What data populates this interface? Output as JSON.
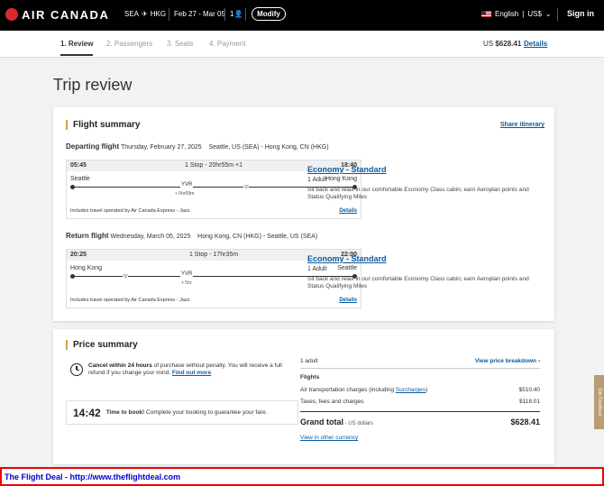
{
  "header": {
    "brand": "AIR CANADA",
    "origin": "SEA",
    "plane_icon": "✈",
    "destination": "HKG",
    "dates": "Feb 27 - Mar 05",
    "passengers": "1",
    "modify_label": "Modify",
    "language": "English",
    "currency": "US$",
    "sign_in": "Sign in"
  },
  "steps": [
    {
      "label": "1. Review"
    },
    {
      "label": "2. Passengers"
    },
    {
      "label": "3. Seats"
    },
    {
      "label": "4. Payment"
    }
  ],
  "top_total": {
    "prefix": "US",
    "amount": "$628.41",
    "details": "Details"
  },
  "page_title": "Trip review",
  "flight_summary": {
    "title": "Flight summary",
    "share": "Share itinerary",
    "departing": {
      "label": "Departing flight",
      "date": "Thursday, February 27, 2025",
      "route": "Seattle, US (SEA) - Hong Kong, CN (HKG)",
      "dep_time": "05:45",
      "stops": "1 Stop - 20hr55m +1",
      "arr_time": "18:40",
      "from_city": "Seattle",
      "to_city": "Hong Kong",
      "stop_code": "YVR",
      "layover": "+ 5hr09m",
      "operated": "Includes travel operated by Air Canada Express - Jazz.",
      "details": "Details",
      "fare_name": "Economy - Standard",
      "fare_pax": "1 Adult",
      "fare_desc": "Sit back and relax in our comfortable Economy Class cabin; earn Aeroplan points and Status Qualifying Miles"
    },
    "return": {
      "label": "Return flight",
      "date": "Wednesday, March 05, 2025",
      "route": "Hong Kong, CN (HKG) - Seattle, US (SEA)",
      "dep_time": "20:25",
      "stops": "1 Stop - 17hr35m",
      "arr_time": "22:00",
      "from_city": "Hong Kong",
      "to_city": "Seattle",
      "stop_code": "YVR",
      "layover": "+ 5hr",
      "operated": "Includes travel operated by Air Canada Express - Jazz.",
      "details": "Details",
      "fare_name": "Economy - Standard",
      "fare_pax": "1 Adult",
      "fare_desc": "Sit back and relax in our comfortable Economy Class cabin; earn Aeroplan points and Status Qualifying Miles"
    }
  },
  "price_summary": {
    "title": "Price summary",
    "cancel_bold": "Cancel within 24 hours",
    "cancel_text": " of purchase without penalty. You will receive a full refund if you change your mind. ",
    "find_out": "Find out more",
    "timer": "14:42",
    "timer_bold": "Time to book!",
    "timer_text": " Complete your booking to guarantee your fare.",
    "adults": "1 adult",
    "view_breakdown": "View price breakdown",
    "flights_label": "Flights",
    "air_label": "Air transportation charges (including ",
    "surcharges": "Surcharges",
    "air_close": ")",
    "air_value": "$510.40",
    "tax_label": "Taxes, fees and charges",
    "tax_value": "$118.01",
    "grand_label": "Grand total",
    "grand_sub": " - US dollars",
    "grand_value": "$628.41",
    "other_currency": "View in other currency"
  },
  "feedback": "Site Feedback",
  "footer_deal": "The Flight Deal - http://www.theflightdeal.com"
}
